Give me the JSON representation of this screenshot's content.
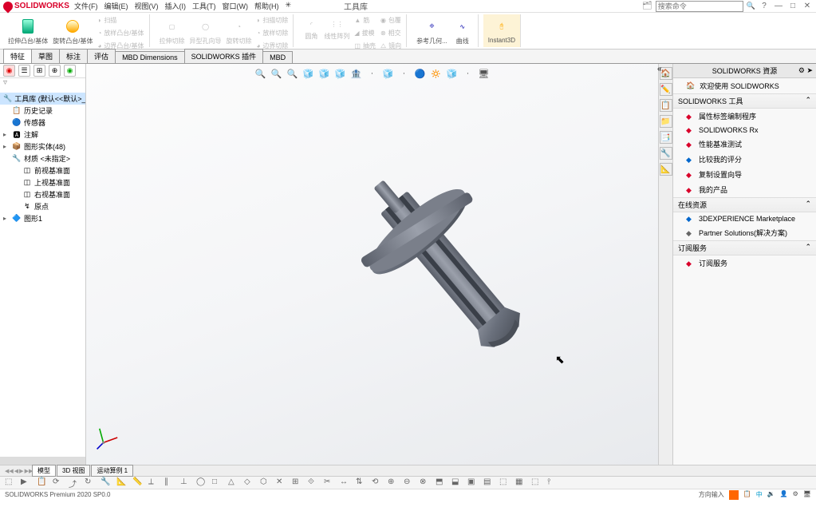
{
  "titlebar": {
    "app_name": "SOLIDWORKS",
    "doc_title": "工具库",
    "search_placeholder": "搜索命令",
    "help_icon": "?"
  },
  "menubar": [
    "文件(F)",
    "编辑(E)",
    "视图(V)",
    "插入(I)",
    "工具(T)",
    "窗口(W)",
    "帮助(H)",
    "✳"
  ],
  "ribbon": {
    "extrude": "拉伸凸台/基体",
    "revolve": "旋转凸台/基体",
    "sweep": "扫描",
    "loft": "放样凸台/基体",
    "boundary": "边界凸台/基体",
    "extrudecut": "拉伸切除",
    "holewizard": "异型孔向导",
    "revolvecut": "旋转切除",
    "sweepcut": "扫描切除",
    "loftcut": "放样切除",
    "boundarycut": "边界切除",
    "fillet": "圆角",
    "pattern": "线性阵列",
    "rib": "筋",
    "draft": "拔模",
    "shell": "抽壳",
    "wrap": "包覆",
    "intersect": "相交",
    "mirror": "镜向",
    "refgeo": "参考几何...",
    "curves": "曲线",
    "instant3d": "Instant3D"
  },
  "tabs": [
    "特征",
    "草图",
    "标注",
    "评估",
    "MBD Dimensions",
    "SOLIDWORKS 插件",
    "MBD"
  ],
  "feature_tree": {
    "root": "工具库 (默认<<默认>_显示",
    "items": [
      {
        "icon": "📋",
        "label": "历史记录"
      },
      {
        "icon": "🔵",
        "label": "传感器"
      },
      {
        "icon": "🅰",
        "label": "注解",
        "arrow": "▸"
      },
      {
        "icon": "📦",
        "label": "图形实体(48)",
        "arrow": "▸"
      },
      {
        "icon": "🔧",
        "label": "材质 <未指定>"
      },
      {
        "icon": "◫",
        "label": "前视基准面",
        "indent": 1
      },
      {
        "icon": "◫",
        "label": "上视基准面",
        "indent": 1
      },
      {
        "icon": "◫",
        "label": "右视基准面",
        "indent": 1
      },
      {
        "icon": "↯",
        "label": "原点",
        "indent": 1
      },
      {
        "icon": "🔷",
        "label": "图形1",
        "arrow": "▸"
      }
    ]
  },
  "view_toolbar": [
    "🔍",
    "🔍",
    "🔍",
    "🧊",
    "🧊",
    "🧊",
    "🏦",
    "·",
    "🧊",
    "·",
    "🔵",
    "🔅",
    "🧊",
    "·",
    "🖥"
  ],
  "resources": {
    "title": "SOLIDWORKS 資源",
    "welcome": "欢迎使用 SOLIDWORKS",
    "sections": [
      {
        "header": "SOLIDWORKS 工具",
        "items": [
          {
            "color": "#d9002a",
            "label": "属性标签编制程序"
          },
          {
            "color": "#d9002a",
            "label": "SOLIDWORKS Rx"
          },
          {
            "color": "#d9002a",
            "label": "性能基准测试"
          },
          {
            "color": "#0066cc",
            "label": "比较我的评分"
          },
          {
            "color": "#d9002a",
            "label": "复制设置向导"
          },
          {
            "color": "#d9002a",
            "label": "我的产品"
          }
        ]
      },
      {
        "header": "在线资源",
        "items": [
          {
            "color": "#0066cc",
            "label": "3DEXPERIENCE Marketplace"
          },
          {
            "color": "#666",
            "label": "Partner Solutions(解决方案)"
          }
        ]
      },
      {
        "header": "订阅服务",
        "items": [
          {
            "color": "#d9002a",
            "label": "订阅服务"
          }
        ]
      }
    ],
    "sidebar_icons": [
      "🏠",
      "✏️",
      "📋",
      "📁",
      "📑",
      "🔧",
      "📐"
    ]
  },
  "bottom_tabs": [
    "模型",
    "3D 视图",
    "运动算例 1"
  ],
  "statusbar": {
    "left": "SOLIDWORKS Premium 2020 SP0.0",
    "right_label": "方向输入"
  }
}
